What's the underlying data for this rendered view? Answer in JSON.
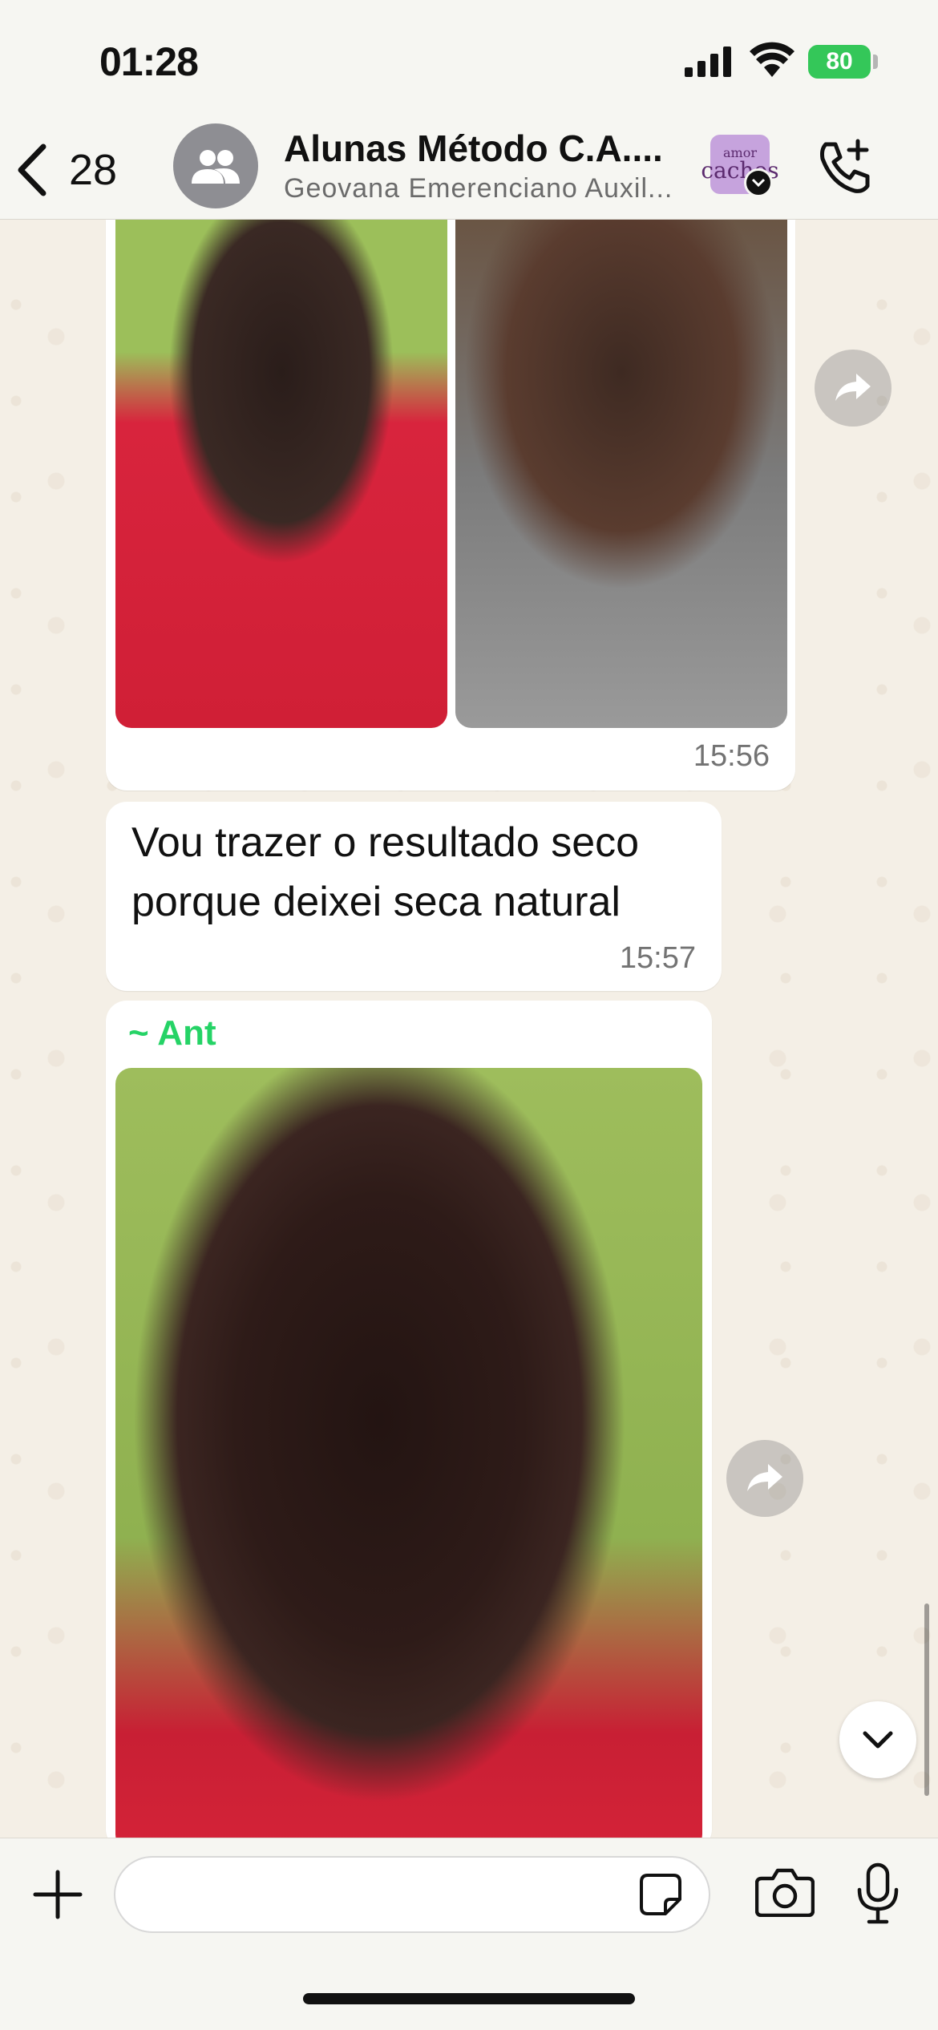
{
  "status_bar": {
    "time": "01:28",
    "battery": "80"
  },
  "header": {
    "back_count": "28",
    "title": "Alunas Método C.A....",
    "subtitle": "Geovana Emerenciano Auxil...",
    "channel_thumb_line1": "amor",
    "channel_thumb_line2": "cachos"
  },
  "messages": [
    {
      "type": "image-pair",
      "time": "15:56"
    },
    {
      "type": "text",
      "lines": [
        "Vou trazer o resultado seco",
        "porque deixei seca natural"
      ],
      "time": "15:57"
    },
    {
      "type": "image",
      "sender": "~ Ant"
    }
  ],
  "input_bar": {
    "placeholder": ""
  },
  "colors": {
    "accent_green": "#25d366",
    "battery_green": "#34c759",
    "wallpaper": "#f4efe6"
  },
  "icons": [
    "chevron-left-icon",
    "group-icon",
    "verified-badge-icon",
    "phone-plus-icon",
    "forward-icon",
    "chevron-down-icon",
    "plus-icon",
    "sticker-icon",
    "camera-icon",
    "microphone-icon"
  ]
}
